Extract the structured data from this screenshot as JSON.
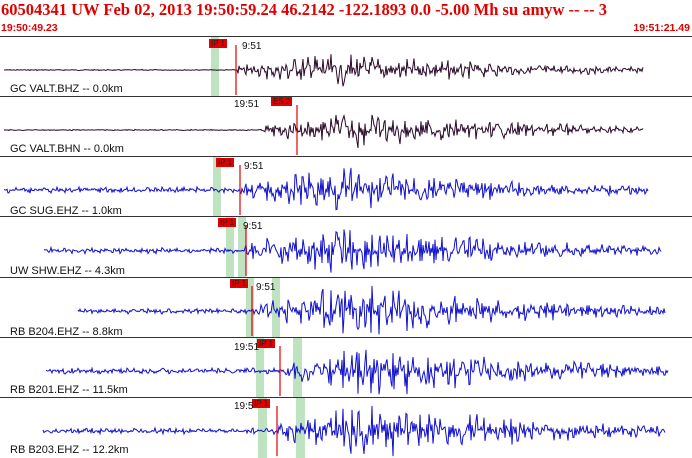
{
  "header": {
    "title": "60504341 UW Feb 02, 2013 19:50:59.24   46.2142 -122.1893  0.0 -5.00 Mh su amyw -- --   3",
    "start_time": "19:50:49.23",
    "end_time": "19:51:21.49"
  },
  "colors": {
    "accent": "#e00000",
    "trace_dark": "#2a0a2a",
    "trace_blue": "#1010d0",
    "highlight": "#bfe3c0",
    "pick_box": "#e00000"
  },
  "channels": [
    {
      "label": "GC VALT.BHZ -- 0.0km",
      "time_mark": "9:51",
      "pick_label": "IP 1",
      "color": "dark",
      "amp": 0.55
    },
    {
      "label": "GC VALT.BHN -- 0.0km",
      "time_mark": "19:51",
      "pick_label": "ES 2",
      "color": "dark",
      "amp": 0.55
    },
    {
      "label": "GC SUG.EHZ -- 1.0km",
      "time_mark": "9:51",
      "pick_label": "IP 1",
      "color": "blue",
      "amp": 0.7
    },
    {
      "label": "UW SHW.EHZ -- 4.3km",
      "time_mark": "9:51",
      "pick_label": "IP 1",
      "color": "blue",
      "amp": 0.8
    },
    {
      "label": "RB B204.EHZ -- 8.8km",
      "time_mark": "9:51",
      "pick_label": "IP 1",
      "color": "blue",
      "amp": 0.85
    },
    {
      "label": "RB B201.EHZ -- 11.5km",
      "time_mark": "19:51",
      "pick_label": "IP 1",
      "color": "blue",
      "amp": 0.8
    },
    {
      "label": "RB B203.EHZ -- 12.2km",
      "time_mark": "19:5",
      "pick_label": "IP 1",
      "color": "blue",
      "amp": 0.9
    }
  ]
}
